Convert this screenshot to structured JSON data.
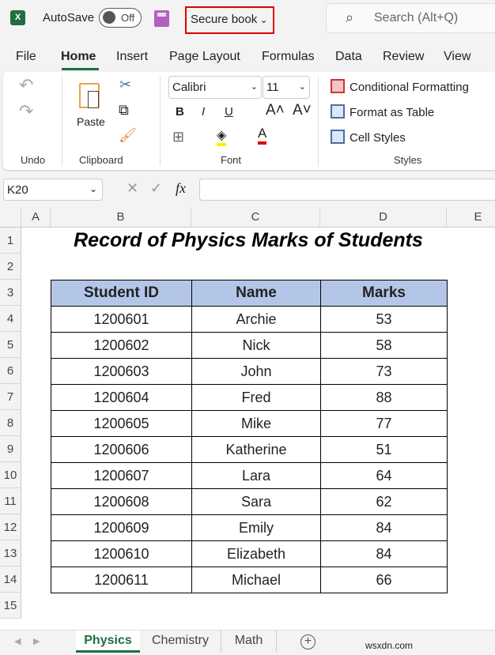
{
  "titlebar": {
    "autosave": "AutoSave",
    "toggle": "Off",
    "filename": "Secure book",
    "search": "Search (Alt+Q)"
  },
  "menu": [
    "File",
    "Home",
    "Insert",
    "Page Layout",
    "Formulas",
    "Data",
    "Review",
    "View"
  ],
  "ribbon": {
    "undo": "Undo",
    "paste": "Paste",
    "clipboard": "Clipboard",
    "font_name": "Calibri",
    "font_size": "11",
    "font": "Font",
    "bold": "B",
    "italic": "I",
    "underline": "U",
    "cond_fmt": "Conditional Formatting",
    "fmt_table": "Format as Table",
    "cell_styles": "Cell Styles",
    "styles": "Styles"
  },
  "formula_bar": {
    "name_box": "K20",
    "fx": "fx",
    "value": ""
  },
  "columns": [
    "A",
    "B",
    "C",
    "D",
    "E"
  ],
  "rows": [
    "1",
    "2",
    "3",
    "4",
    "5",
    "6",
    "7",
    "8",
    "9",
    "10",
    "11",
    "12",
    "13",
    "14",
    "15"
  ],
  "sheet": {
    "title": "Record of Physics Marks of Students",
    "headers": [
      "Student ID",
      "Name",
      "Marks"
    ],
    "data": [
      [
        "1200601",
        "Archie",
        "53"
      ],
      [
        "1200602",
        "Nick",
        "58"
      ],
      [
        "1200603",
        "John",
        "73"
      ],
      [
        "1200604",
        "Fred",
        "88"
      ],
      [
        "1200605",
        "Mike",
        "77"
      ],
      [
        "1200606",
        "Katherine",
        "51"
      ],
      [
        "1200607",
        "Lara",
        "64"
      ],
      [
        "1200608",
        "Sara",
        "62"
      ],
      [
        "1200609",
        "Emily",
        "84"
      ],
      [
        "1200610",
        "Elizabeth",
        "84"
      ],
      [
        "1200611",
        "Michael",
        "66"
      ]
    ]
  },
  "tabs": [
    "Physics",
    "Chemistry",
    "Math"
  ],
  "watermark": "wsxdn.com",
  "colors": {
    "accent": "#1e6e42",
    "header_fill": "#b4c6e7",
    "highlight_box": "#e00000"
  }
}
